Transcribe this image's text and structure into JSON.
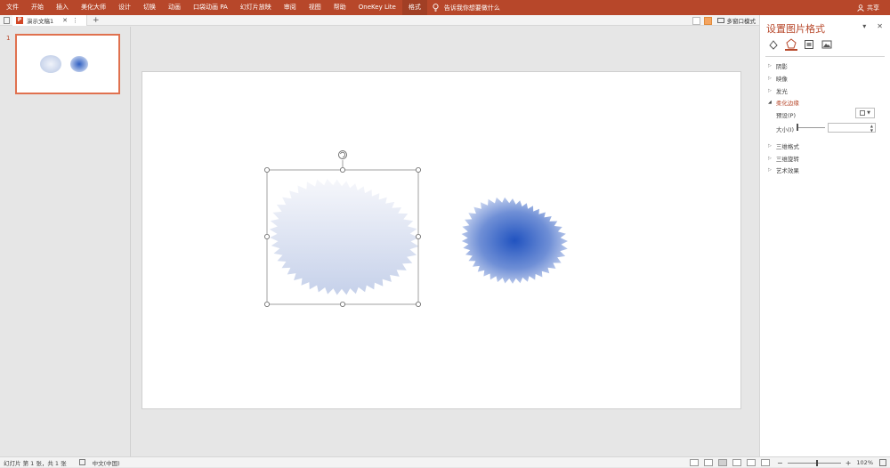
{
  "ribbon": {
    "tabs": [
      "文件",
      "开始",
      "插入",
      "美化大师",
      "设计",
      "切换",
      "动画",
      "口袋动画 PA",
      "幻灯片放映",
      "审阅",
      "视图",
      "帮助",
      "OneKey Lite",
      "格式"
    ],
    "active_tab": "格式",
    "tell_me": "告诉我你想要做什么",
    "share": "共享",
    "color": "#b7472a"
  },
  "tabbar": {
    "doc_title": "演示文稿1",
    "multi_window": "多窗口模式"
  },
  "thumbnails": {
    "slide_number": "1"
  },
  "format_pane": {
    "title": "设置图片格式",
    "sections": {
      "shadow": "阴影",
      "reflection": "映像",
      "glow": "发光",
      "soft_edges": "柔化边缘",
      "format_3d": "三维格式",
      "rotation_3d": "三维旋转",
      "artistic": "艺术效果"
    },
    "preset_label": "预设(P)",
    "size_label": "大小(I)"
  },
  "statusbar": {
    "slide_info": "幻灯片 第 1 张，共 1 张",
    "language": "中文(中国)",
    "zoom": "102%"
  }
}
